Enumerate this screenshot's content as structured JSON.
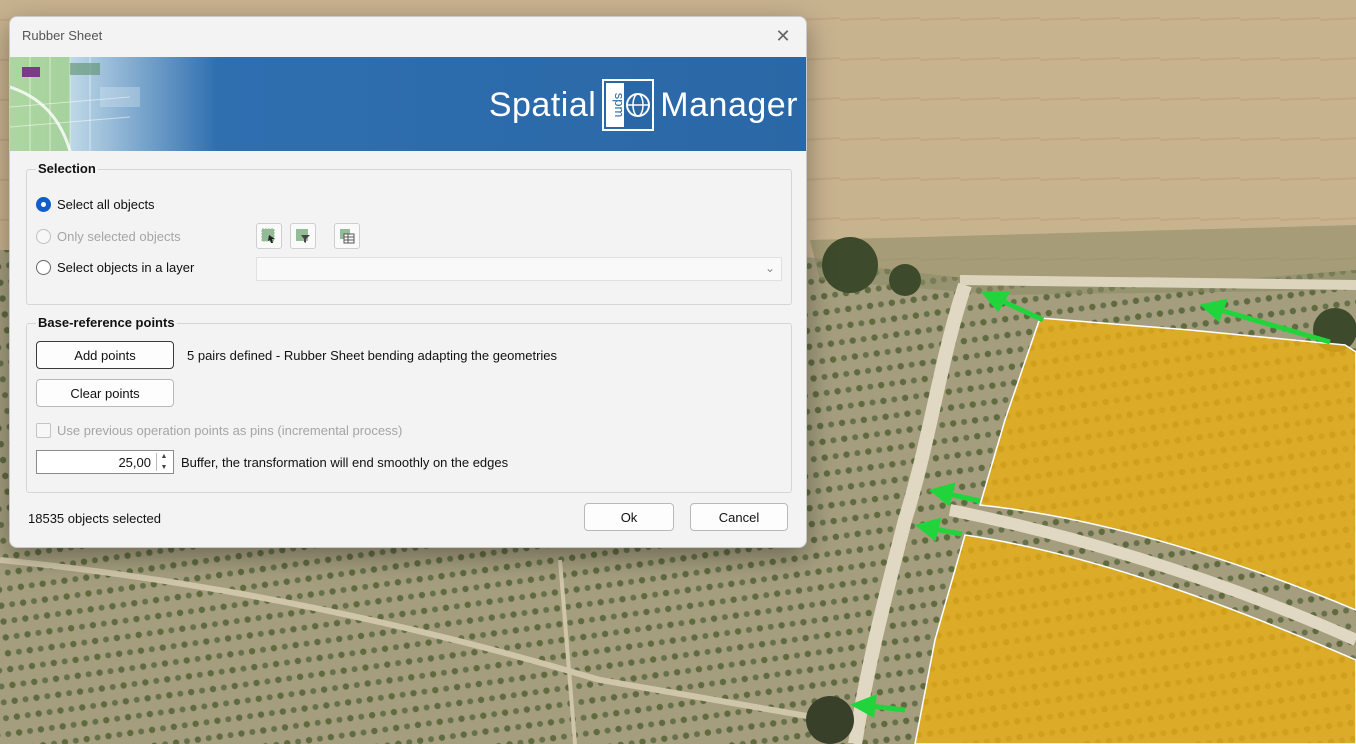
{
  "dialog": {
    "title": "Rubber Sheet",
    "brand": {
      "left": "Spatial",
      "mark": "spm",
      "right": "Manager"
    },
    "selection": {
      "label": "Selection",
      "options": [
        {
          "label": "Select all objects",
          "checked": true,
          "enabled": true
        },
        {
          "label": "Only selected objects",
          "checked": false,
          "enabled": false
        },
        {
          "label": "Select objects in a layer",
          "checked": false,
          "enabled": true
        }
      ],
      "tool_icons": [
        "select-window-icon",
        "select-filter-icon",
        "select-table-icon"
      ],
      "layer_combo_value": ""
    },
    "base_reference": {
      "label": "Base-reference points",
      "add_points_label": "Add points",
      "status": "5 pairs defined - Rubber Sheet bending adapting the geometries",
      "clear_points_label": "Clear points",
      "use_previous_label": "Use previous operation points as pins (incremental process)",
      "buffer_value": "25,00",
      "buffer_desc": "Buffer, the transformation will end smoothly on the edges"
    },
    "footer": {
      "count_text": "18535 objects selected",
      "ok_label": "Ok",
      "cancel_label": "Cancel"
    }
  },
  "colors": {
    "banner_blue": "#2a67a6",
    "radio_blue": "#0f5ecb",
    "parcel_fill": "#e8ad14",
    "arrow_green": "#22d43b"
  }
}
